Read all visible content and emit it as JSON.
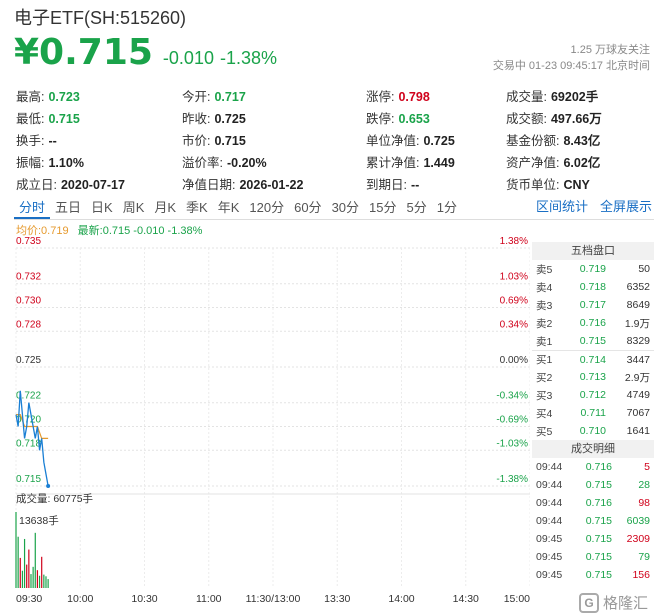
{
  "header": {
    "title": "电子ETF(SH:515260)",
    "price": "¥0.715",
    "change": "-0.010",
    "change_pct": "-1.38%",
    "followers": "1.25 万球友关注",
    "status": "交易中 01-23 09:45:17 北京时间"
  },
  "quote_rows": [
    [
      {
        "label": "最高:",
        "value": "0.723",
        "color": "green"
      },
      {
        "label": "今开:",
        "value": "0.717",
        "color": "green"
      },
      {
        "label": "涨停:",
        "value": "0.798",
        "color": "red"
      },
      {
        "label": "成交量:",
        "value": "69202手",
        "color": ""
      }
    ],
    [
      {
        "label": "最低:",
        "value": "0.715",
        "color": "green"
      },
      {
        "label": "昨收:",
        "value": "0.725",
        "color": ""
      },
      {
        "label": "跌停:",
        "value": "0.653",
        "color": "green"
      },
      {
        "label": "成交额:",
        "value": "497.66万",
        "color": ""
      }
    ],
    [
      {
        "label": "换手:",
        "value": "--",
        "color": ""
      },
      {
        "label": "市价:",
        "value": "0.715",
        "color": ""
      },
      {
        "label": "单位净值:",
        "value": "0.725",
        "color": ""
      },
      {
        "label": "基金份额:",
        "value": "8.43亿",
        "color": ""
      }
    ],
    [
      {
        "label": "振幅:",
        "value": "1.10%",
        "color": ""
      },
      {
        "label": "溢价率:",
        "value": "-0.20%",
        "color": ""
      },
      {
        "label": "累计净值:",
        "value": "1.449",
        "color": ""
      },
      {
        "label": "资产净值:",
        "value": "6.02亿",
        "color": ""
      }
    ],
    [
      {
        "label": "成立日:",
        "value": "2020-07-17",
        "color": ""
      },
      {
        "label": "净值日期:",
        "value": "2026-01-22",
        "color": ""
      },
      {
        "label": "到期日:",
        "value": "--",
        "color": ""
      },
      {
        "label": "货币单位:",
        "value": "CNY",
        "color": ""
      }
    ]
  ],
  "tabs": [
    "分时",
    "五日",
    "日K",
    "周K",
    "月K",
    "季K",
    "年K",
    "120分",
    "60分",
    "30分",
    "15分",
    "5分",
    "1分"
  ],
  "active_tab": "分时",
  "tabs_right": [
    "区间统计",
    "全屏展示"
  ],
  "legend": {
    "avg": "均价:0.719",
    "latest": "最新:0.715 -0.010 -1.38%"
  },
  "colors": {
    "up": "#d0021b",
    "down": "#1aa34a",
    "avg_line": "#e69a2e",
    "price_line": "#1a7fd4",
    "accent": "#1a6fc4"
  },
  "chart_data": {
    "type": "line",
    "y_ticks": [
      "0.735",
      "0.732",
      "0.730",
      "0.728",
      "0.725",
      "0.722",
      "0.720",
      "0.718",
      "0.715"
    ],
    "y_tick_values": [
      0.735,
      0.732,
      0.73,
      0.728,
      0.725,
      0.722,
      0.72,
      0.718,
      0.715
    ],
    "pct_ticks": [
      "1.38%",
      "1.03%",
      "0.69%",
      "0.34%",
      "0.00%",
      "-0.34%",
      "-0.69%",
      "-1.03%",
      "-1.38%"
    ],
    "x_ticks": [
      "09:30",
      "10:00",
      "10:30",
      "11:00",
      "11:30/13:00",
      "13:30",
      "14:00",
      "14:30",
      "15:00"
    ],
    "ylim": [
      0.715,
      0.735
    ],
    "price_series": {
      "name": "最新",
      "minutes": [
        0,
        1,
        2,
        3,
        4,
        5,
        6,
        7,
        8,
        9,
        10,
        11,
        12,
        13,
        14,
        15
      ],
      "values": [
        0.721,
        0.72,
        0.723,
        0.721,
        0.719,
        0.72,
        0.722,
        0.721,
        0.72,
        0.719,
        0.72,
        0.718,
        0.719,
        0.717,
        0.716,
        0.715
      ]
    },
    "avg_series": {
      "name": "均价",
      "minutes": [
        0,
        2,
        4,
        6,
        8,
        10,
        12,
        14,
        15
      ],
      "values": [
        0.721,
        0.721,
        0.72,
        0.72,
        0.72,
        0.72,
        0.719,
        0.719,
        0.719
      ]
    },
    "volume_label": "成交量: 60775手",
    "volume_max_label": "13638手",
    "volume_max": 13638,
    "volume_bars": [
      13638,
      9200,
      5400,
      3100,
      8800,
      4200,
      6900,
      2500,
      3800,
      9900,
      3200,
      2200,
      5600,
      2400,
      2100,
      1600
    ],
    "volume_colors": [
      "green",
      "green",
      "red",
      "green",
      "green",
      "red",
      "red",
      "green",
      "green",
      "green",
      "red",
      "green",
      "red",
      "green",
      "green",
      "green"
    ]
  },
  "order_book": {
    "title": "五档盘口",
    "sells": [
      {
        "side": "卖5",
        "price": "0.719",
        "vol": "50"
      },
      {
        "side": "卖4",
        "price": "0.718",
        "vol": "6352"
      },
      {
        "side": "卖3",
        "price": "0.717",
        "vol": "8649"
      },
      {
        "side": "卖2",
        "price": "0.716",
        "vol": "1.9万"
      },
      {
        "side": "卖1",
        "price": "0.715",
        "vol": "8329"
      }
    ],
    "buys": [
      {
        "side": "买1",
        "price": "0.714",
        "vol": "3447"
      },
      {
        "side": "买2",
        "price": "0.713",
        "vol": "2.9万"
      },
      {
        "side": "买3",
        "price": "0.712",
        "vol": "4749"
      },
      {
        "side": "买4",
        "price": "0.711",
        "vol": "7067"
      },
      {
        "side": "买5",
        "price": "0.710",
        "vol": "1641"
      }
    ],
    "trades_title": "成交明细",
    "trades": [
      {
        "time": "09:44",
        "price": "0.716",
        "vol": "5",
        "color": "red"
      },
      {
        "time": "09:44",
        "price": "0.715",
        "vol": "28",
        "color": "green"
      },
      {
        "time": "09:44",
        "price": "0.716",
        "vol": "98",
        "color": "red"
      },
      {
        "time": "09:44",
        "price": "0.715",
        "vol": "6039",
        "color": "green"
      },
      {
        "time": "09:45",
        "price": "0.715",
        "vol": "2309",
        "color": "red"
      },
      {
        "time": "09:45",
        "price": "0.715",
        "vol": "79",
        "color": "green"
      },
      {
        "time": "09:45",
        "price": "0.715",
        "vol": "156",
        "color": "red"
      }
    ]
  },
  "watermark": {
    "logo": "G",
    "text": "格隆汇"
  }
}
